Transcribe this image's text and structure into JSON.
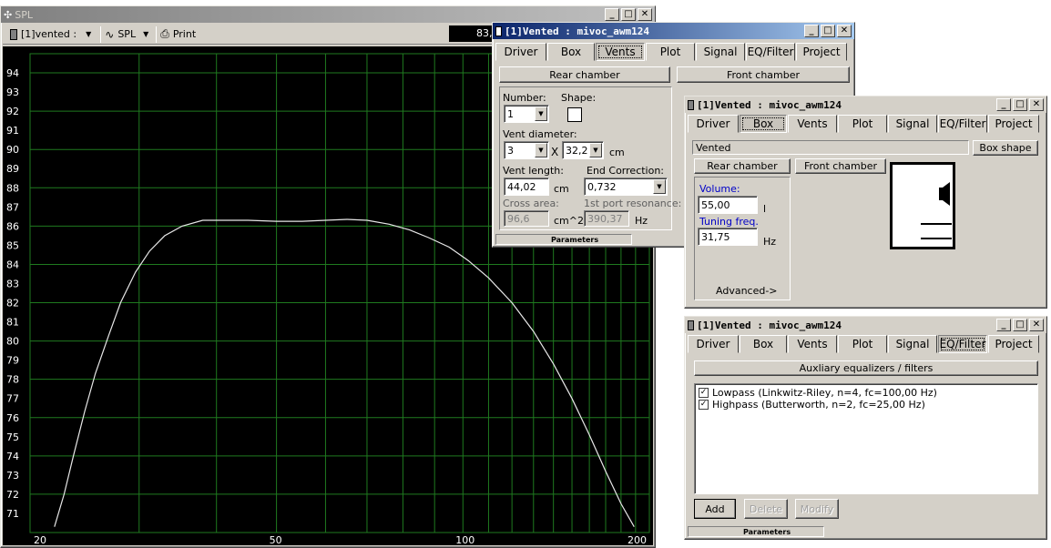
{
  "main": {
    "title": "SPL",
    "toolbar": {
      "source": "[1]vented :",
      "view": "SPL",
      "print": "Print",
      "readout": "83,"
    },
    "y_ticks": [
      "94",
      "93",
      "92",
      "91",
      "90",
      "89",
      "88",
      "87",
      "86",
      "85",
      "84",
      "83",
      "82",
      "81",
      "80",
      "79",
      "78",
      "77",
      "76",
      "75",
      "74",
      "73",
      "72",
      "71"
    ],
    "x_ticks": [
      "20",
      "50",
      "100",
      "200"
    ]
  },
  "chart_data": {
    "type": "line",
    "xscale": "log",
    "xlim": [
      20,
      200
    ],
    "ylim": [
      70,
      95
    ],
    "x_tick_labels": [
      "20",
      "50",
      "100",
      "200"
    ],
    "y_tick_labels": [
      "94",
      "93",
      "92",
      "91",
      "90",
      "89",
      "88",
      "87",
      "86",
      "85",
      "84",
      "83",
      "82",
      "81",
      "80",
      "79",
      "78",
      "77",
      "76",
      "75",
      "74",
      "73",
      "72",
      "71"
    ],
    "grid": true,
    "background": "#000000",
    "grid_color": "#1f7a1f",
    "line_color": "#e8e8e8",
    "series": [
      {
        "x": [
          21.9,
          22.7,
          23.5,
          24.5,
          25.5,
          26.8,
          28.0,
          29.6,
          31.2,
          33.0,
          35.2,
          38.0,
          41.0,
          45.0,
          50.0,
          55.0,
          60.0,
          65.0,
          70.0,
          76.0,
          82.0,
          88.0,
          95.0,
          102.0,
          110.0,
          120.0,
          130.0,
          140.0,
          150.0,
          160.0,
          170.0,
          180.0,
          189.0
        ],
        "y": [
          70.3,
          72.0,
          74.0,
          76.3,
          78.3,
          80.3,
          82.0,
          83.6,
          84.7,
          85.5,
          86.0,
          86.3,
          86.3,
          86.3,
          86.25,
          86.25,
          86.3,
          86.35,
          86.3,
          86.1,
          85.8,
          85.4,
          84.9,
          84.2,
          83.3,
          82.0,
          80.5,
          78.8,
          77.0,
          75.1,
          73.2,
          71.5,
          70.3
        ]
      }
    ]
  },
  "vents_window": {
    "title": "[1]Vented : mivoc_awm124",
    "tabs": [
      "Driver",
      "Box",
      "Vents",
      "Plot",
      "Signal",
      "EQ/Filter",
      "Project"
    ],
    "selected_tab": "Vents",
    "rear_chamber": "Rear chamber",
    "front_chamber": "Front chamber",
    "number_label": "Number:",
    "number_value": "1",
    "shape_label": "Shape:",
    "vent_diameter_label": "Vent diameter:",
    "vent_diameter_value": "3",
    "times": "X",
    "vent_size_value": "32,2",
    "cm": "cm",
    "vent_length_label": "Vent length:",
    "vent_length_value": "44,02",
    "end_correction_label": "End Correction:",
    "end_correction_value": "0,732",
    "cross_area_label": "Cross area:",
    "cross_area_value": "96,6",
    "cross_area_unit": "cm^2",
    "port_resonance_label": "1st port resonance:",
    "port_resonance_value": "390,37",
    "hz": "Hz",
    "status": "Parameters"
  },
  "box_window": {
    "title": "[1]Vented : mivoc_awm124",
    "tabs": [
      "Driver",
      "Box",
      "Vents",
      "Plot",
      "Signal",
      "EQ/Filter",
      "Project"
    ],
    "selected_tab": "Box",
    "box_type": "Vented",
    "box_shape": "Box shape",
    "rear_chamber": "Rear chamber",
    "front_chamber": "Front chamber",
    "volume_label": "Volume:",
    "volume_value": "55,00",
    "volume_unit": "l",
    "tuning_label": "Tuning freq.",
    "tuning_value": "31,75",
    "tuning_unit": "Hz",
    "advanced": "Advanced->"
  },
  "eq_window": {
    "title": "[1]Vented : mivoc_awm124",
    "tabs": [
      "Driver",
      "Box",
      "Vents",
      "Plot",
      "Signal",
      "EQ/Filter",
      "Project"
    ],
    "selected_tab": "EQ/Filter",
    "aux_header": "Auxliary equalizers / filters",
    "filters": [
      {
        "label": "Lowpass (Linkwitz-Riley, n=4, fc=100,00 Hz)",
        "checked": true
      },
      {
        "label": "Highpass (Butterworth, n=2, fc=25,00 Hz)",
        "checked": true
      }
    ],
    "add": "Add",
    "delete": "Delete",
    "modify": "Modify",
    "status": "Parameters"
  },
  "colors": {
    "accent_blue": "#0a246a",
    "highlight_text": "#0000c8"
  }
}
